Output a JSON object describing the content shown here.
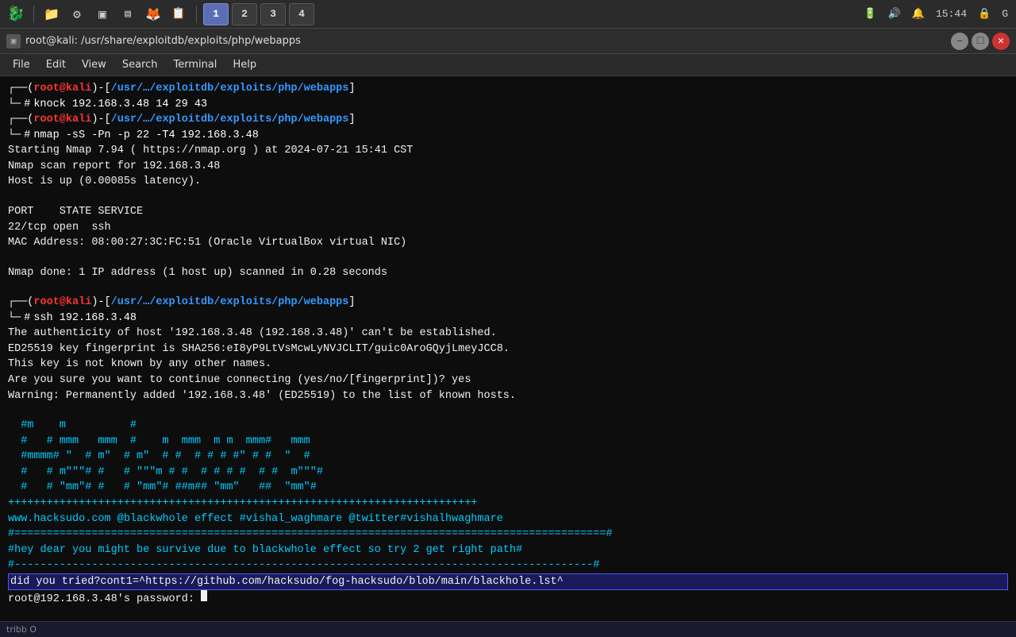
{
  "taskbar": {
    "icons": [
      {
        "name": "kali-icon",
        "symbol": "🐉",
        "active": false
      },
      {
        "name": "file-manager",
        "symbol": "📁",
        "active": false
      },
      {
        "name": "settings",
        "symbol": "⚙",
        "active": false
      },
      {
        "name": "terminal-taskbar",
        "symbol": "▣",
        "active": false
      },
      {
        "name": "firefox",
        "symbol": "🦊",
        "active": false
      },
      {
        "name": "app6",
        "symbol": "📋",
        "active": false
      }
    ],
    "workspace_buttons": [
      "1",
      "2",
      "3",
      "4"
    ],
    "active_workspace": "1",
    "time": "15:44",
    "tray_icons": [
      "🔋",
      "🔊",
      "🔔",
      "🔒",
      "G"
    ]
  },
  "title_bar": {
    "title": "root@kali: /usr/share/exploitdb/exploits/php/webapps",
    "icon": "▣"
  },
  "menu": {
    "items": [
      "File",
      "Edit",
      "View",
      "Search",
      "Terminal",
      "Help"
    ]
  },
  "terminal": {
    "lines": [
      {
        "type": "prompt_cmd",
        "user": "root@kali",
        "path": "/usr/…/exploitdb/exploits/php/webapps",
        "cmd": "knock 192.168.3.48 14 29 43"
      },
      {
        "type": "prompt_cmd",
        "user": "root@kali",
        "path": "/usr/…/exploitdb/exploits/php/webapps",
        "cmd": "nmap -sS -Pn -p 22 -T4 192.168.3.48"
      },
      {
        "type": "output",
        "text": "Starting Nmap 7.94 ( https://nmap.org ) at 2024-07-21 15:41 CST"
      },
      {
        "type": "output",
        "text": "Nmap scan report for 192.168.3.48"
      },
      {
        "type": "output",
        "text": "Host is up (0.00085s latency)."
      },
      {
        "type": "empty"
      },
      {
        "type": "output",
        "text": "PORT    STATE SERVICE"
      },
      {
        "type": "output",
        "text": "22/tcp open  ssh"
      },
      {
        "type": "output",
        "text": "MAC Address: 08:00:27:3C:FC:51 (Oracle VirtualBox virtual NIC)"
      },
      {
        "type": "empty"
      },
      {
        "type": "output",
        "text": "Nmap done: 1 IP address (1 host up) scanned in 0.28 seconds"
      },
      {
        "type": "empty"
      },
      {
        "type": "prompt_cmd",
        "user": "root@kali",
        "path": "/usr/…/exploitdb/exploits/php/webapps",
        "cmd": "ssh 192.168.3.48"
      },
      {
        "type": "output",
        "text": "The authenticity of host '192.168.3.48 (192.168.3.48)' can't be established."
      },
      {
        "type": "output",
        "text": "ED25519 key fingerprint is SHA256:eI8yP9LtVsMcwLyNVJCLIT/guic0AroGQyjLmeyJCC8."
      },
      {
        "type": "output",
        "text": "This key is not known by any other names."
      },
      {
        "type": "output",
        "text": "Are you sure you want to continue connecting (yes/no/[fingerprint])? yes"
      },
      {
        "type": "output",
        "text": "Warning: Permanently added '192.168.3.48' (ED25519) to the list of known hosts."
      },
      {
        "type": "empty"
      },
      {
        "type": "ascii",
        "text": " #m    m          #\n #   # mmm   mmm  #    m  mmm  m m  mmm#   mmm\n #mmmm# \"  # m\"  # m\"  # #  # # # #\" # #  \"  #\n #   # m\"\"\"# #   # \"\"\"m # #  # # # #  # #  m\"\"\"#\n #   # \"mm\"# #   # \"mm\"# ##m## \"mm\"   ##  \"mm\"#"
      },
      {
        "type": "divider",
        "text": "+++++++++++++++++++++++++++++++++++++++++++++++++++++++++++++++++++++++"
      },
      {
        "type": "site",
        "text": "www.hacksudo.com @blackwhole effect #vishal_waghmare @twitter#vishalhwaghmare"
      },
      {
        "type": "hash_div",
        "text": "#============================================================================================#"
      },
      {
        "type": "msg",
        "text": "#hey dear you might be survive due to blackwhole effect so try 2 get right path#"
      },
      {
        "type": "hash_div2",
        "text": "#------------------------------------------------------------------------------------------#"
      },
      {
        "type": "url_line",
        "text": "did you tried?cont1=^https://github.com/hacksudo/fog-hacksudo/blob/main/blackhole.lst^"
      },
      {
        "type": "password",
        "text": "root@192.168.3.48's password: "
      }
    ]
  },
  "status_bar": {
    "items": [
      "tribb O"
    ]
  }
}
